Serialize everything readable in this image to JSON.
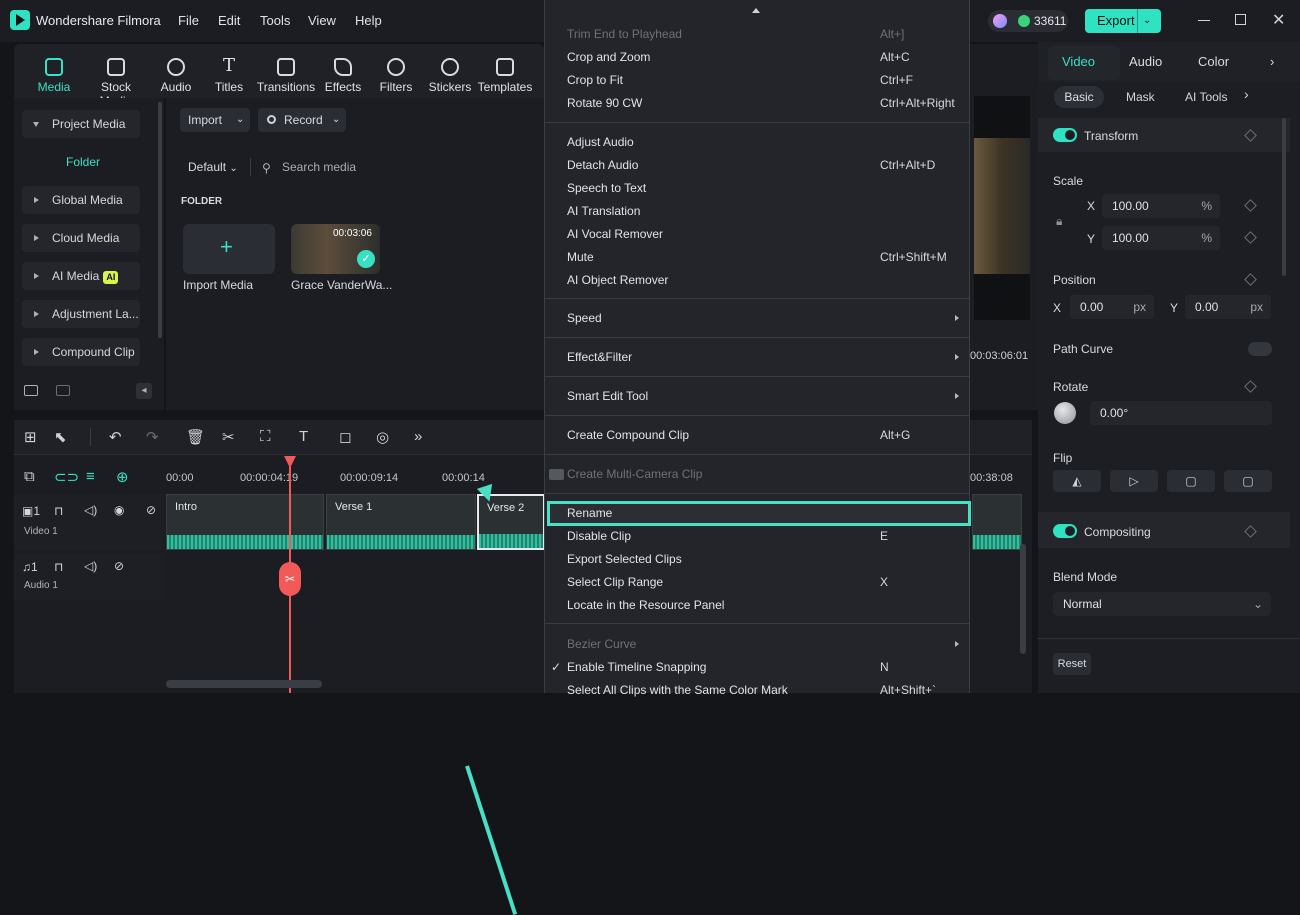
{
  "app": {
    "title": "Wondershare Filmora",
    "credits": "33611",
    "export_label": "Export"
  },
  "menubar": [
    "File",
    "Edit",
    "Tools",
    "View",
    "Help"
  ],
  "toolbar": [
    "Media",
    "Stock Media",
    "Audio",
    "Titles",
    "Transitions",
    "Effects",
    "Filters",
    "Stickers",
    "Templates"
  ],
  "sidebar": {
    "project_media": "Project Media",
    "folder": "Folder",
    "items": [
      "Global Media",
      "Cloud Media",
      "AI Media",
      "Adjustment La...",
      "Compound Clip"
    ],
    "ai_badge": "AI"
  },
  "media": {
    "import_label": "Import",
    "record_label": "Record",
    "sort_label": "Default",
    "search_placeholder": "Search media",
    "folder_heading": "FOLDER",
    "import_media_label": "Import Media",
    "clip_name": "Grace VanderWa...",
    "clip_duration": "00:03:06"
  },
  "context_menu": {
    "items": [
      {
        "label": "Trim End to Playhead",
        "shortcut": "Alt+]",
        "disabled": true
      },
      {
        "label": "Crop and Zoom",
        "shortcut": "Alt+C"
      },
      {
        "label": "Crop to Fit",
        "shortcut": "Ctrl+F"
      },
      {
        "label": "Rotate 90 CW",
        "shortcut": "Ctrl+Alt+Right"
      },
      {
        "label": "Adjust Audio",
        "shortcut": ""
      },
      {
        "label": "Detach Audio",
        "shortcut": "Ctrl+Alt+D"
      },
      {
        "label": "Speech to Text",
        "shortcut": ""
      },
      {
        "label": "AI Translation",
        "shortcut": ""
      },
      {
        "label": "AI Vocal Remover",
        "shortcut": ""
      },
      {
        "label": "Mute",
        "shortcut": "Ctrl+Shift+M"
      },
      {
        "label": "AI Object Remover",
        "shortcut": ""
      },
      {
        "label": "Speed",
        "shortcut": "",
        "submenu": true
      },
      {
        "label": "Effect&Filter",
        "shortcut": "",
        "submenu": true
      },
      {
        "label": "Smart Edit Tool",
        "shortcut": "",
        "submenu": true
      },
      {
        "label": "Create Compound Clip",
        "shortcut": "Alt+G"
      },
      {
        "label": "Create Multi-Camera Clip",
        "shortcut": "",
        "disabled": true
      },
      {
        "label": "Rename",
        "shortcut": "",
        "highlighted": true
      },
      {
        "label": "Disable Clip",
        "shortcut": "E"
      },
      {
        "label": "Export Selected Clips",
        "shortcut": ""
      },
      {
        "label": "Select Clip Range",
        "shortcut": "X"
      },
      {
        "label": "Locate in the Resource Panel",
        "shortcut": ""
      },
      {
        "label": "Bezier Curve",
        "shortcut": "",
        "disabled": true,
        "submenu": true
      },
      {
        "label": "Enable Timeline Snapping",
        "shortcut": "N",
        "checked": true
      },
      {
        "label": "Select All Clips with the Same Color Mark",
        "shortcut": "Alt+Shift+`"
      }
    ]
  },
  "preview": {
    "time": "00:03:06:01"
  },
  "right_panel": {
    "tabs": [
      "Video",
      "Audio",
      "Color"
    ],
    "subtabs": [
      "Basic",
      "Mask",
      "AI Tools"
    ],
    "transform": "Transform",
    "scale": "Scale",
    "scale_x": "100.00",
    "scale_y": "100.00",
    "scale_unit": "%",
    "x_label": "X",
    "y_label": "Y",
    "position": "Position",
    "pos_x": "0.00",
    "pos_y": "0.00",
    "px": "px",
    "path_curve": "Path Curve",
    "rotate": "Rotate",
    "rotate_value": "0.00°",
    "flip": "Flip",
    "compositing": "Compositing",
    "blend_mode": "Blend Mode",
    "blend_value": "Normal",
    "reset": "Reset"
  },
  "timeline": {
    "ruler": [
      "00:00",
      "00:00:04:19",
      "00:00:09:14",
      "00:00:14",
      "00:38:08"
    ],
    "clips": [
      "Intro",
      "Verse 1",
      "Verse 2"
    ],
    "video_track": "Video 1",
    "audio_track": "Audio 1"
  }
}
